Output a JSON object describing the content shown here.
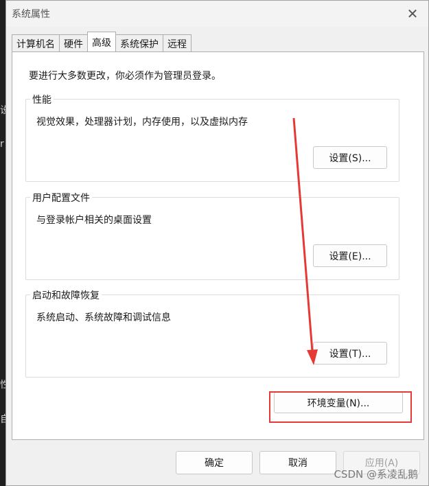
{
  "window": {
    "title": "系统属性"
  },
  "background": {
    "chars": [
      "设",
      "r",
      "性",
      "自"
    ]
  },
  "tabs": [
    {
      "label": "计算机名"
    },
    {
      "label": "硬件"
    },
    {
      "label": "高级"
    },
    {
      "label": "系统保护"
    },
    {
      "label": "远程"
    }
  ],
  "panel": {
    "intro": "要进行大多数更改，你必须作为管理员登录。",
    "performance": {
      "label": "性能",
      "desc": "视觉效果，处理器计划，内存使用，以及虚拟内存",
      "button": "设置(S)..."
    },
    "user_profiles": {
      "label": "用户配置文件",
      "desc": "与登录帐户相关的桌面设置",
      "button": "设置(E)..."
    },
    "startup_recovery": {
      "label": "启动和故障恢复",
      "desc": "系统启动、系统故障和调试信息",
      "button": "设置(T)..."
    },
    "env_button": "环境变量(N)..."
  },
  "footer": {
    "ok": "确定",
    "cancel": "取消",
    "apply": "应用(A)"
  },
  "watermark": "CSDN @系凌乱鹅",
  "annotation_color": "#e53935"
}
